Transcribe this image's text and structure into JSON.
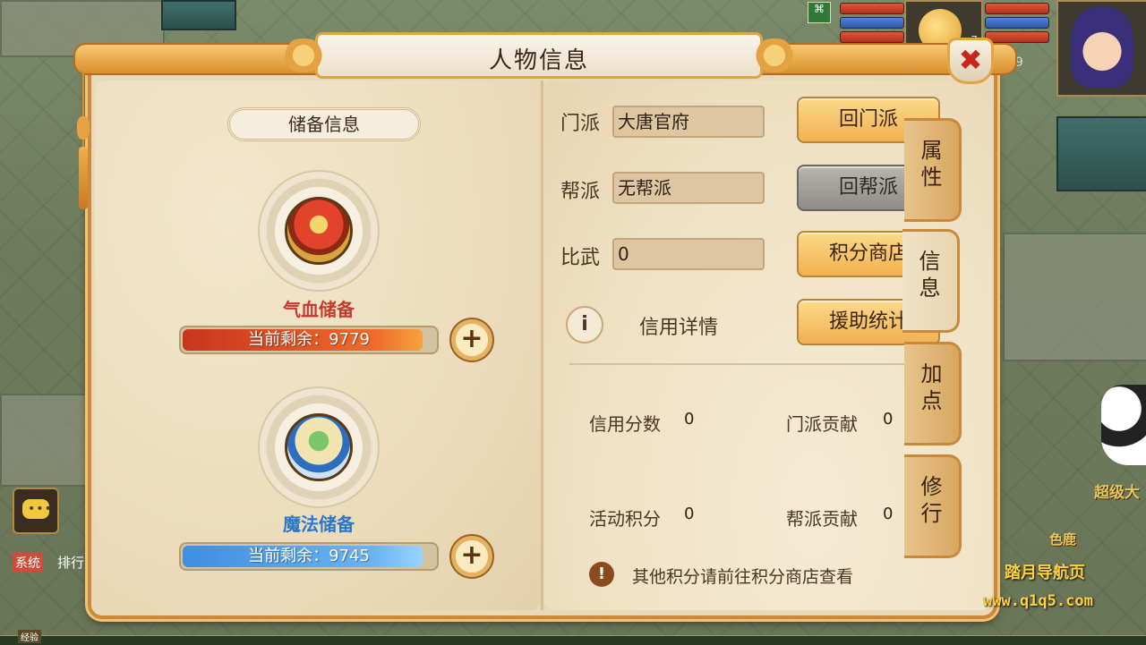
{
  "panel": {
    "title": "人物信息",
    "close_icon": "close-x-icon"
  },
  "storage": {
    "section_title": "储备信息",
    "hp": {
      "label": "气血储备",
      "remaining_text": "当前剩余：9779",
      "fill_fraction": 0.95,
      "bar_color": "#e2432b"
    },
    "mp": {
      "label": "魔法储备",
      "remaining_text": "当前剩余：9745",
      "fill_fraction": 0.95,
      "bar_color": "#3f8ee0"
    },
    "plus_label": "+"
  },
  "info": {
    "sect": {
      "label": "门派",
      "value": "大唐官府",
      "button": "回门派"
    },
    "guild": {
      "label": "帮派",
      "value": "无帮派",
      "button": "回帮派"
    },
    "pvp": {
      "label": "比武",
      "value": "0",
      "button": "积分商店"
    },
    "credit": {
      "icon_text": "i",
      "link": "信用详情",
      "button": "援助统计"
    },
    "stats": {
      "credit_score": {
        "label": "信用分数",
        "value": "0"
      },
      "sect_contrib": {
        "label": "门派贡献",
        "value": "0"
      },
      "activity_points": {
        "label": "活动积分",
        "value": "0"
      },
      "guild_contrib": {
        "label": "帮派贡献",
        "value": "0"
      }
    },
    "note_icon": "!",
    "note": "其他积分请前往积分商店查看"
  },
  "tabs": [
    {
      "label": "属性",
      "active": false
    },
    {
      "label": "信息",
      "active": true
    },
    {
      "label": "加点",
      "active": false
    },
    {
      "label": "修行",
      "active": false
    }
  ],
  "hud": {
    "pet_level": "7",
    "hero_level": "109",
    "buff_icon_text": "⌘"
  },
  "chat": {
    "system_tag": "系统",
    "system_text": "排行",
    "exp_label": "经验"
  },
  "world": {
    "npc_name": "超级大",
    "npc_name2": "色鹿"
  },
  "watermark": {
    "line1": "踏月导航页",
    "line2": "www.q1q5.com"
  },
  "colors": {
    "accent": "#f1b14f",
    "frame": "#c98a3d",
    "close_red": "#c8251c"
  }
}
